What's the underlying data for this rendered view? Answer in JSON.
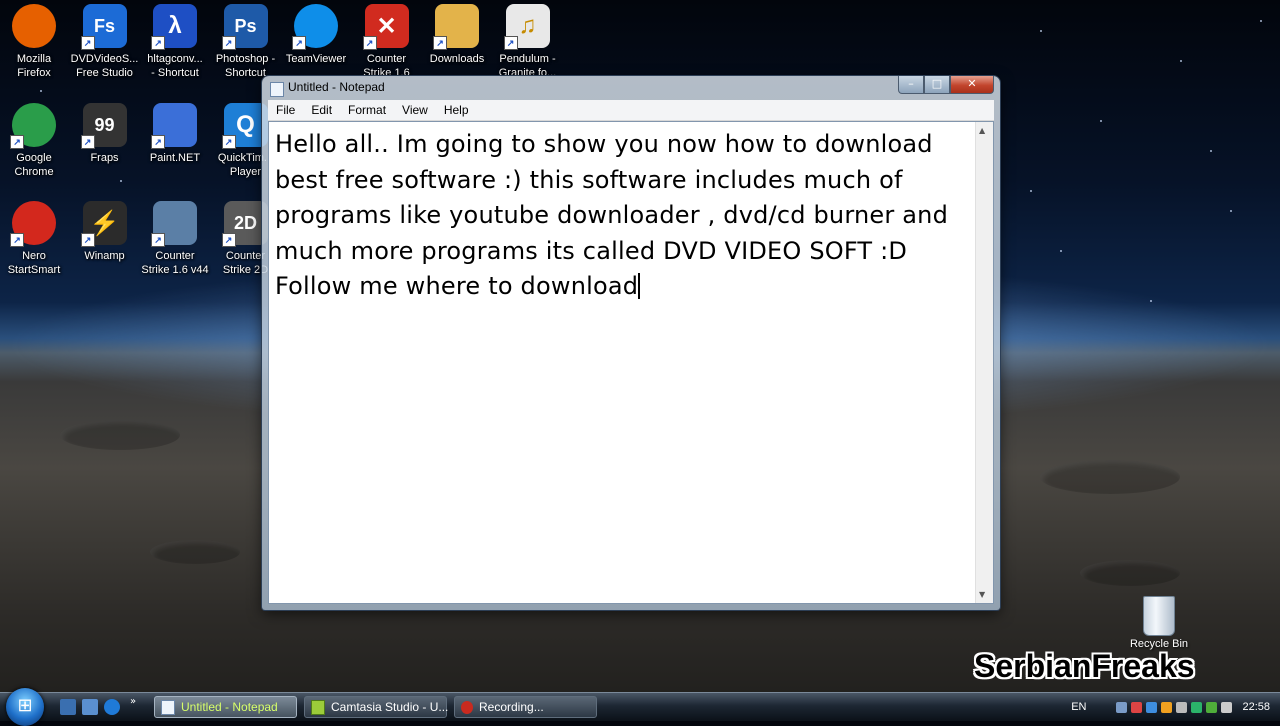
{
  "desktop_icons": [
    {
      "label": "Mozilla\nFirefox",
      "icon": "firefox-icon",
      "color": "#e66000"
    },
    {
      "label": "DVDVideoS...\nFree Studio",
      "icon": "fs-icon",
      "glyph": "Fs",
      "color": "#1c6bd6"
    },
    {
      "label": "hltagconv...\n- Shortcut",
      "icon": "lambda-icon",
      "glyph": "λ",
      "color": "#1e4fc4"
    },
    {
      "label": "Photoshop -\nShortcut",
      "icon": "photoshop-icon",
      "glyph": "Ps",
      "color": "#1e5aa8"
    },
    {
      "label": "TeamViewer",
      "icon": "teamviewer-icon",
      "color": "#0e8ee9"
    },
    {
      "label": "Counter\nStrike 1.6",
      "icon": "red-x-icon",
      "glyph": "✕",
      "color": "#d12b1f"
    },
    {
      "label": "Downloads",
      "icon": "folder-icon",
      "color": "#e3b34a"
    },
    {
      "label": "Pendulum -\nGranite fo...",
      "icon": "audio-file-icon",
      "glyph": "♫",
      "color": "#e8e8e8"
    },
    {
      "label": "Google\nChrome",
      "icon": "chrome-icon",
      "color": "#2a9d4a"
    },
    {
      "label": "Fraps",
      "icon": "fraps-icon",
      "glyph": "99",
      "color": "#333333"
    },
    {
      "label": "Paint.NET",
      "icon": "paintnet-icon",
      "color": "#3b6fd8"
    },
    {
      "label": "QuickTim...\nPlayer",
      "icon": "quicktime-icon",
      "glyph": "Q",
      "color": "#1e7fd6"
    },
    {
      "label": "Nero\nStartSmart",
      "icon": "nero-icon",
      "color": "#d3281d"
    },
    {
      "label": "Winamp",
      "icon": "winamp-icon",
      "glyph": "⚡",
      "color": "#2b2b2b"
    },
    {
      "label": "Counter\nStrike 1.6 v44",
      "icon": "cs-icon",
      "color": "#5b7fa6"
    },
    {
      "label": "Counter\nStrike 2D",
      "icon": "cs2d-icon",
      "glyph": "2D",
      "color": "#5a5a5a"
    }
  ],
  "notepad": {
    "title": "Untitled - Notepad",
    "menu": [
      "File",
      "Edit",
      "Format",
      "View",
      "Help"
    ],
    "buttons": {
      "minimize": "–",
      "maximize": "□",
      "close": "✕"
    },
    "content": "Hello all.. Im going to show you now how to download\nbest free software :) this software includes much of\nprograms like youtube downloader , dvd/cd burner and\nmuch more programs its called DVD VIDEO SOFT :D\nFollow me where to download"
  },
  "recycle_bin": {
    "label": "Recycle Bin"
  },
  "watermark": "SerbianFreaks",
  "taskbar": {
    "buttons": [
      {
        "label": "Untitled - Notepad",
        "active": true
      },
      {
        "label": "Camtasia Studio - U...",
        "active": false
      },
      {
        "label": "Recording...",
        "active": false
      }
    ],
    "language": "EN",
    "clock": "22:58"
  }
}
